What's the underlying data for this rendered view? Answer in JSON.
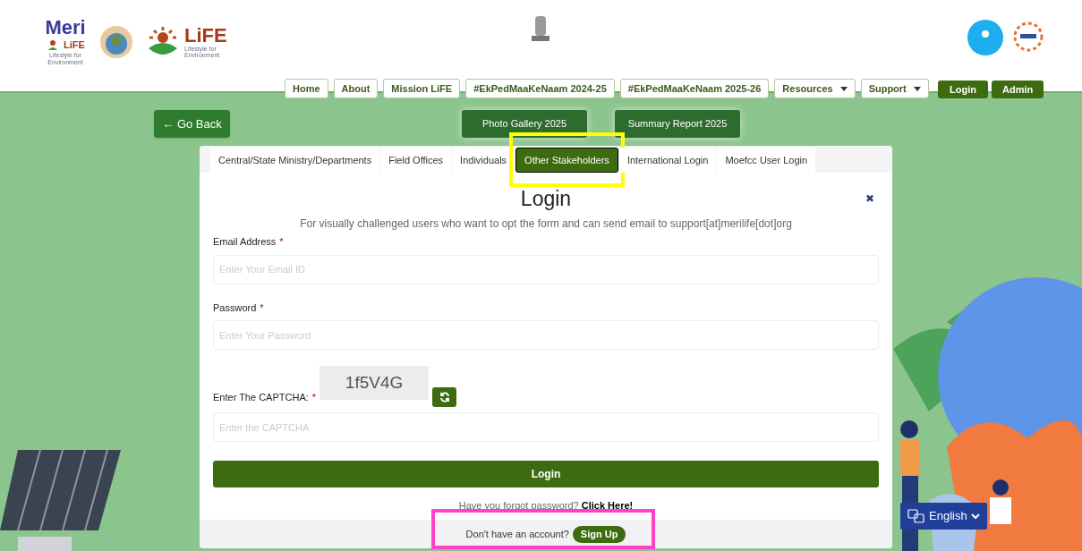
{
  "header": {
    "logo": {
      "title": "Meri",
      "subtitle": "LiFE",
      "tagline": "Lifestyle for Environment"
    },
    "life_logo": {
      "title": "LiFE",
      "tagline": "Lifestyle for Environment"
    },
    "nav": [
      {
        "label": "Home",
        "dropdown": false
      },
      {
        "label": "About",
        "dropdown": false
      },
      {
        "label": "Mission LiFE",
        "dropdown": false
      },
      {
        "label": "#EkPedMaaKeNaam 2024-25",
        "dropdown": false
      },
      {
        "label": "#EkPedMaaKeNaam 2025-26",
        "dropdown": false
      },
      {
        "label": "Resources",
        "dropdown": true
      },
      {
        "label": "Support",
        "dropdown": true
      }
    ],
    "actions": [
      "Login",
      "Admin"
    ]
  },
  "go_back": "← Go Back",
  "top_buttons": [
    "Photo Gallery 2025",
    "Summary Report 2025"
  ],
  "tabs": [
    {
      "label": "Central/State Ministry/Departments",
      "selected": false
    },
    {
      "label": "Field Offices",
      "selected": false
    },
    {
      "label": "Individuals",
      "selected": false
    },
    {
      "label": "Other Stakeholders",
      "selected": true
    },
    {
      "label": "International Login",
      "selected": false
    },
    {
      "label": "Moefcc User Login",
      "selected": false
    }
  ],
  "form": {
    "title": "Login",
    "close": "✖",
    "note": "For visually challenged users who want to opt the form and can send email to support[at]merilife[dot]org",
    "fields": [
      {
        "label": "Email Address",
        "required_mark": "*",
        "placeholder": "Enter Your Email ID",
        "kind": "text"
      },
      {
        "label": "Password",
        "required_mark": "*",
        "placeholder": "Enter Your Password",
        "kind": "password"
      },
      {
        "label": "Enter The CAPTCHA:",
        "required_mark": "*",
        "placeholder": "Enter the CAPTCHA",
        "kind": "captcha",
        "captcha": "1f5V4G"
      }
    ],
    "submit": "Login",
    "forgot": "Have you forgot password? **Click Here!**",
    "signup_prompt": "Don't have an account?",
    "signup": "Sign Up"
  },
  "language": "English"
}
